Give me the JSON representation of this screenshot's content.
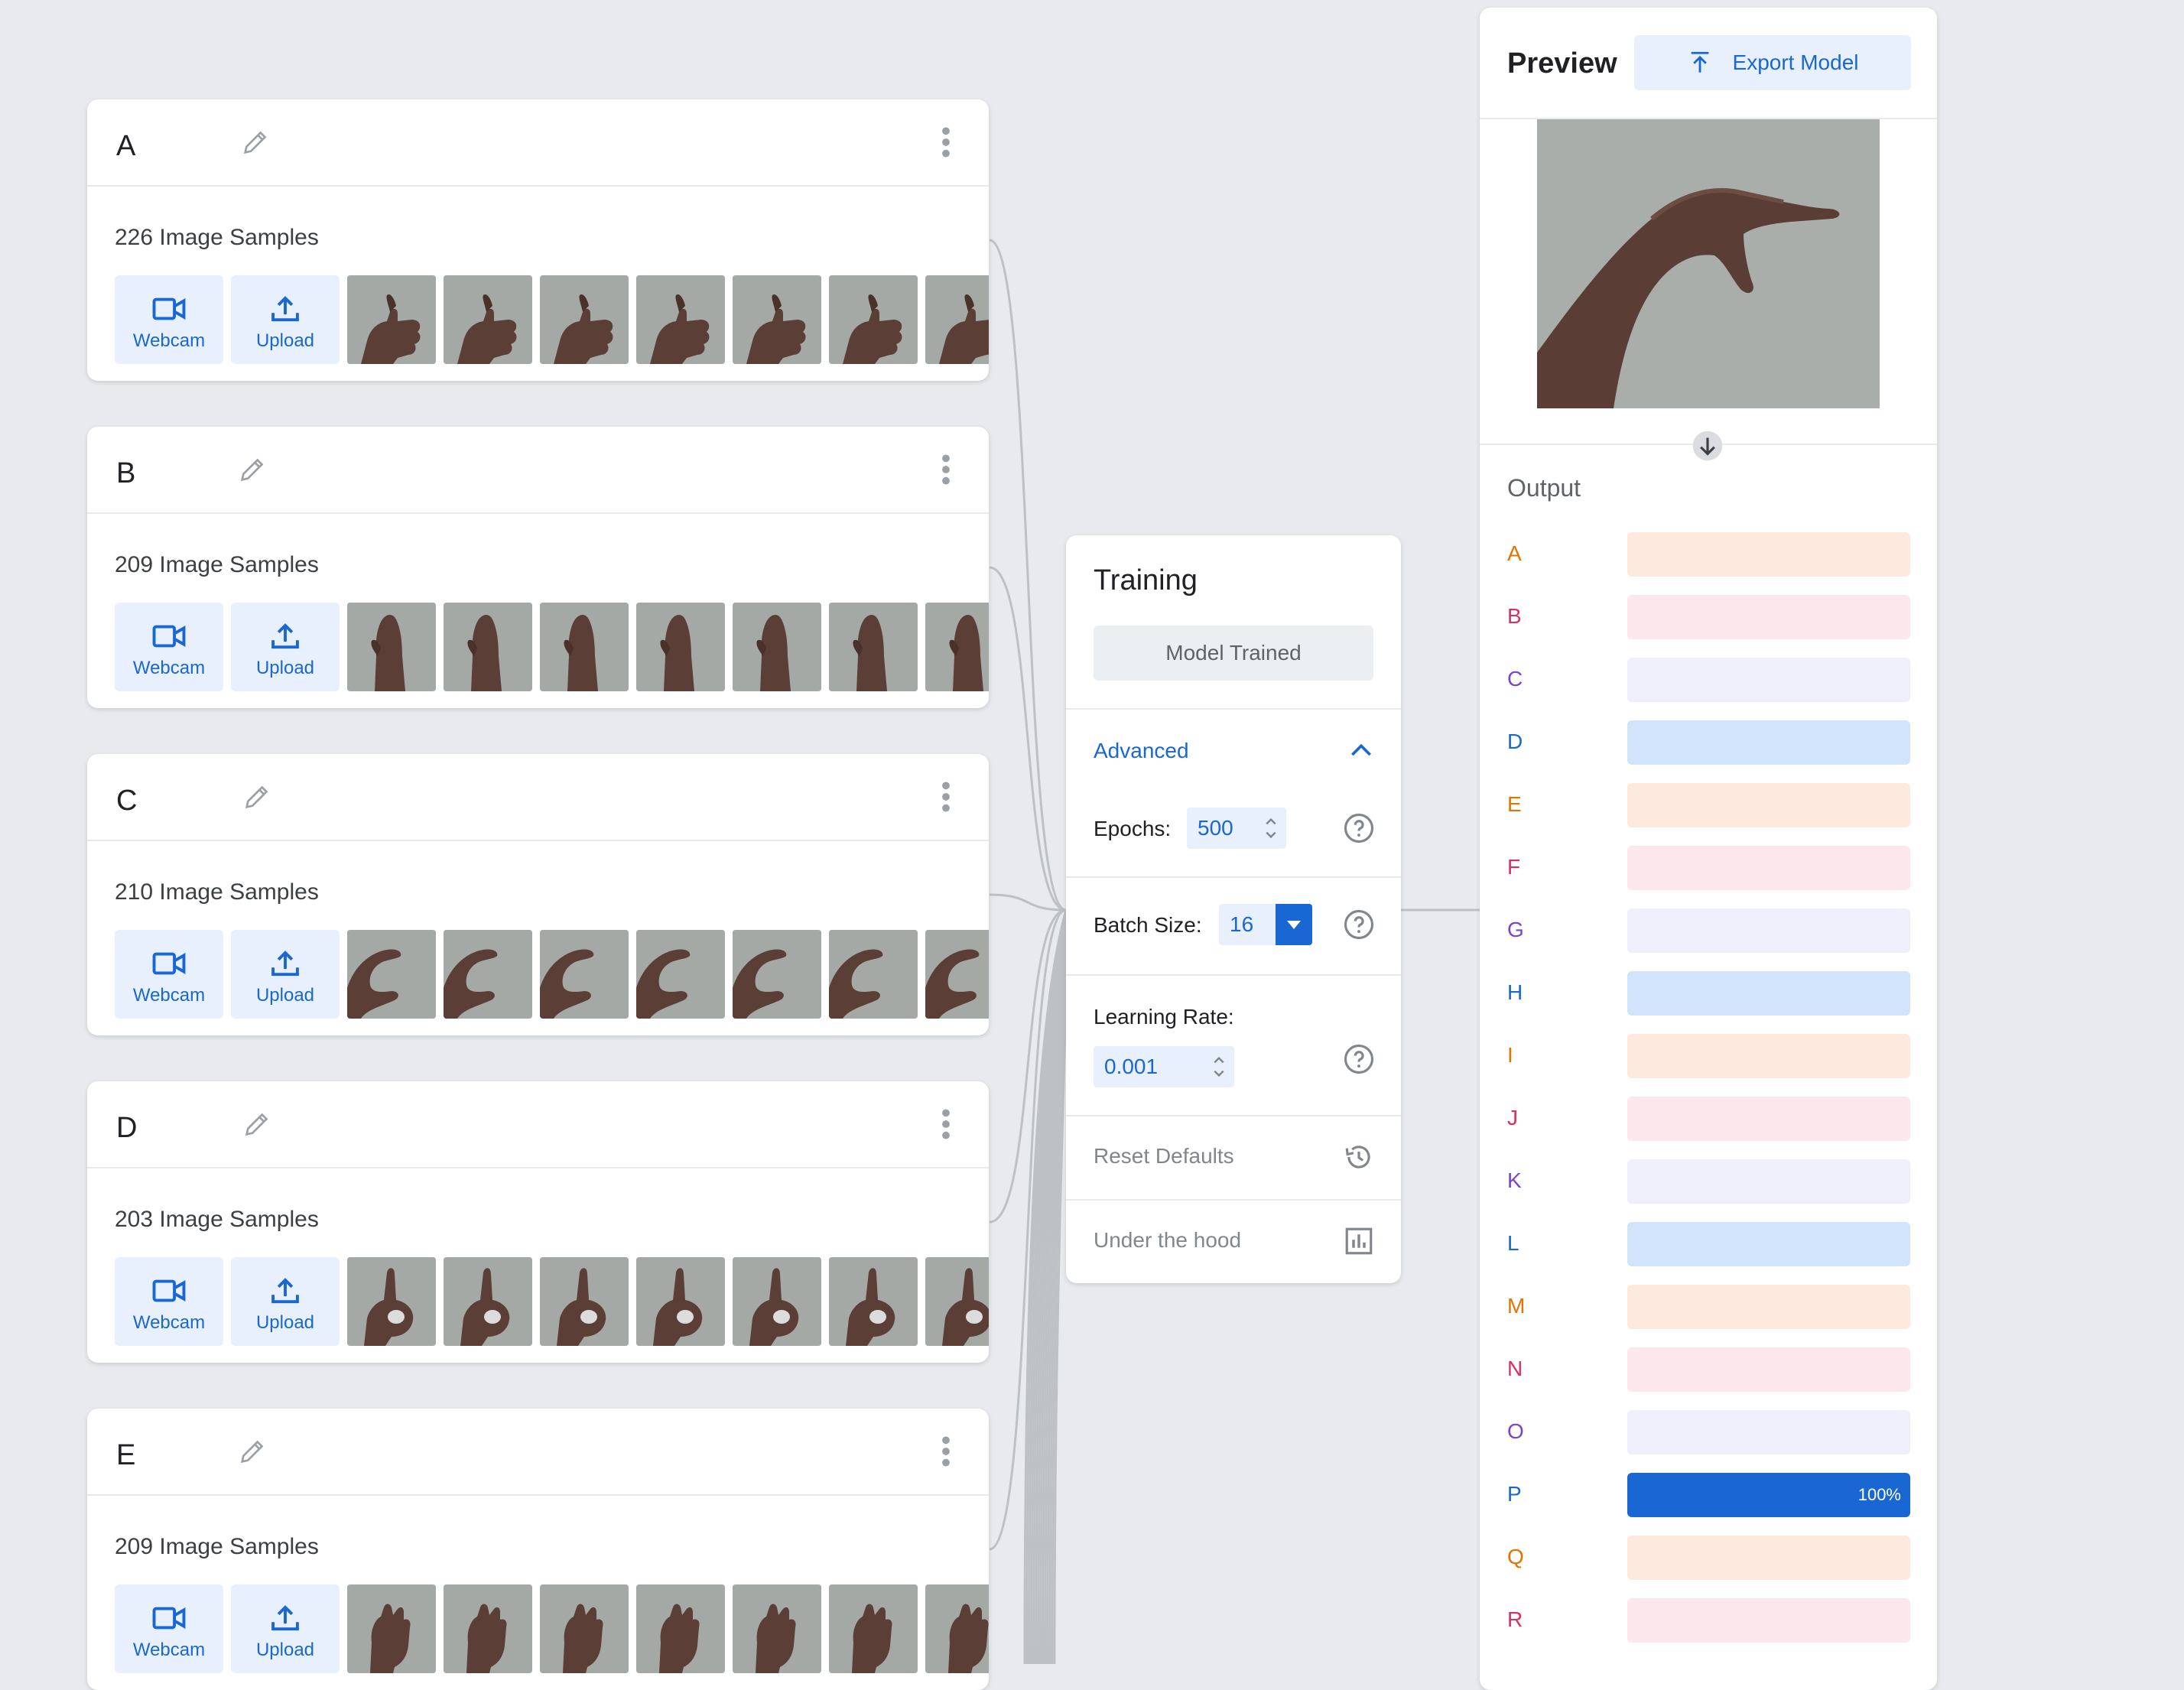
{
  "classes": [
    {
      "name": "A",
      "samples": "226 Image Samples",
      "gesture": "fist"
    },
    {
      "name": "B",
      "samples": "209 Image Samples",
      "gesture": "flat"
    },
    {
      "name": "C",
      "samples": "210 Image Samples",
      "gesture": "curve"
    },
    {
      "name": "D",
      "samples": "203 Image Samples",
      "gesture": "point-up"
    },
    {
      "name": "E",
      "samples": "209 Image Samples",
      "gesture": "closed"
    }
  ],
  "class_card": {
    "webcam_label": "Webcam",
    "upload_label": "Upload",
    "thumbnail_count": 7
  },
  "training": {
    "title": "Training",
    "trained_button": "Model Trained",
    "advanced_label": "Advanced",
    "epochs_label": "Epochs:",
    "epochs_value": "500",
    "batch_label": "Batch Size:",
    "batch_value": "16",
    "lr_label": "Learning Rate:",
    "lr_value": "0.001",
    "reset_label": "Reset Defaults",
    "hood_label": "Under the hood"
  },
  "preview": {
    "title": "Preview",
    "export_label": "Export Model",
    "output_title": "Output",
    "predictions": [
      {
        "label": "A",
        "value": 0,
        "text": "#e37400",
        "track": "#fde9de"
      },
      {
        "label": "B",
        "value": 0,
        "text": "#d93062",
        "track": "#fce8ec"
      },
      {
        "label": "C",
        "value": 0,
        "text": "#7a43ce",
        "track": "#efeefb"
      },
      {
        "label": "D",
        "value": 0,
        "text": "#1967d2",
        "track": "#d2e3fc"
      },
      {
        "label": "E",
        "value": 0,
        "text": "#e37400",
        "track": "#fde9de"
      },
      {
        "label": "F",
        "value": 0,
        "text": "#d93062",
        "track": "#fce8ec"
      },
      {
        "label": "G",
        "value": 0,
        "text": "#7a43ce",
        "track": "#efeefb"
      },
      {
        "label": "H",
        "value": 0,
        "text": "#1967d2",
        "track": "#d2e3fc"
      },
      {
        "label": "I",
        "value": 0,
        "text": "#e37400",
        "track": "#fde9de"
      },
      {
        "label": "J",
        "value": 0,
        "text": "#d93062",
        "track": "#fce8ec"
      },
      {
        "label": "K",
        "value": 0,
        "text": "#7a43ce",
        "track": "#efeefb"
      },
      {
        "label": "L",
        "value": 0,
        "text": "#1967d2",
        "track": "#d2e3fc"
      },
      {
        "label": "M",
        "value": 0,
        "text": "#e37400",
        "track": "#fde9de"
      },
      {
        "label": "N",
        "value": 0,
        "text": "#d93062",
        "track": "#fce8ec"
      },
      {
        "label": "O",
        "value": 0,
        "text": "#7a43ce",
        "track": "#efeefb"
      },
      {
        "label": "P",
        "value": 100,
        "percent_label": "100%",
        "text": "#1967d2",
        "track": "#d2e3fc",
        "fill": "#1967d2"
      },
      {
        "label": "Q",
        "value": 0,
        "text": "#e37400",
        "track": "#fde9de"
      },
      {
        "label": "R",
        "value": 0,
        "text": "#d93062",
        "track": "#fce8ec"
      }
    ]
  },
  "colors": {
    "accent": "#1967d2",
    "accent_light": "#e8f0fe",
    "background": "#e8eaed",
    "connector": "#bdc1c6"
  }
}
